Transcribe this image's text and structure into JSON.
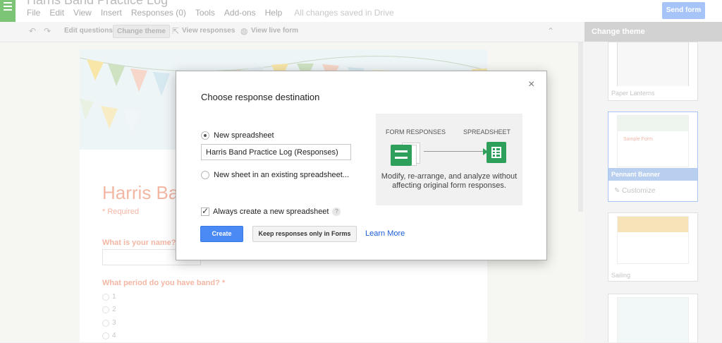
{
  "app": {
    "doc_title": "Harris Band Practice Log",
    "menus": [
      "File",
      "Edit",
      "View",
      "Insert",
      "Responses (0)",
      "Tools",
      "Add-ons",
      "Help"
    ],
    "save_status": "All changes saved in Drive",
    "send_label": "Send form"
  },
  "toolbar": {
    "edit_questions": "Edit questions",
    "change_theme": "Change theme",
    "view_responses": "View responses",
    "view_live_form": "View live form"
  },
  "form": {
    "title_visible": "Harris Ba",
    "required_note": "* Required",
    "question1": "What is your name?",
    "question2": "What period do you have band? *",
    "options": [
      "1",
      "2",
      "3",
      "4"
    ]
  },
  "theme_panel": {
    "header": "Change theme",
    "themes": [
      {
        "name": "Paper Lanterns",
        "selected": false
      },
      {
        "name": "Pennant Banner",
        "selected": true
      },
      {
        "name": "Sailing",
        "selected": false
      }
    ],
    "customize_label": "Customize",
    "thumb_title": "Sample Form"
  },
  "dialog": {
    "title": "Choose response destination",
    "close": "×",
    "option_new": "New spreadsheet",
    "option_new_selected": true,
    "spreadsheet_name": "Harris Band Practice Log (Responses)",
    "option_existing": "New sheet in an existing spreadsheet...",
    "always_create": "Always create a new spreadsheet",
    "always_create_checked": true,
    "help": "?",
    "create_label": "Create",
    "keep_label": "Keep responses only in Forms",
    "learn_more": "Learn More",
    "illustration": {
      "left_label": "FORM RESPONSES",
      "right_label": "SPREADSHEET",
      "caption_line1": "Modify, re-arrange, and analyze without",
      "caption_line2": "affecting original form responses."
    }
  },
  "colors": {
    "accent_blue": "#4a8af4",
    "forms_green": "#2fa05c",
    "link_blue": "#1a5bd6",
    "form_title_peach": "#f4b7a4"
  }
}
